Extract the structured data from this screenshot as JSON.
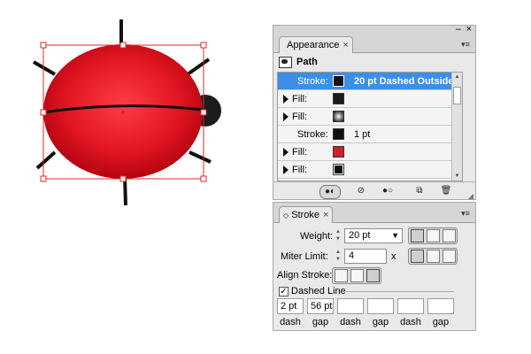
{
  "appearance_panel": {
    "tab_label": "Appearance",
    "close_glyph": "×",
    "header_label": "Path",
    "rows": [
      {
        "kind": "Stroke:",
        "value": "20 pt Dashed Outside",
        "swatch_color": "#111111",
        "selected": true
      },
      {
        "kind": "Fill:",
        "value": "",
        "swatch_color": "#1a1a1a",
        "selected": false
      },
      {
        "kind": "Fill:",
        "value": "",
        "swatch_color": "radial-gray",
        "selected": false
      },
      {
        "kind": "Stroke:",
        "value": "1 pt",
        "swatch_color": "#111111",
        "selected": false
      },
      {
        "kind": "Fill:",
        "value": "",
        "swatch_color": "#d31d2a",
        "selected": false
      },
      {
        "kind": "Fill:",
        "value": "",
        "swatch_color": "#111111",
        "selected": false
      }
    ],
    "footer_icons": [
      "add-new-stroke-icon",
      "clear-appearance-icon",
      "reduce-to-basic-icon",
      "duplicate-item-icon",
      "delete-item-icon"
    ]
  },
  "stroke_panel": {
    "tab_label": "Stroke",
    "close_glyph": "×",
    "weight_label": "Weight:",
    "weight_value": "20 pt",
    "miter_label": "Miter Limit:",
    "miter_value": "4",
    "miter_unit": "x",
    "align_label": "Align Stroke:",
    "dashed_label": "Dashed Line",
    "dashed_checked": true,
    "dash_values": [
      "2 pt",
      "56 pt",
      "",
      "",
      "",
      ""
    ],
    "dash_labels": [
      "dash",
      "gap",
      "dash",
      "gap",
      "dash",
      "gap"
    ]
  },
  "colors": {
    "selection_blue": "#3d8fe5",
    "ladybug_red": "#e01522",
    "bounding_box": "#e0262f"
  }
}
